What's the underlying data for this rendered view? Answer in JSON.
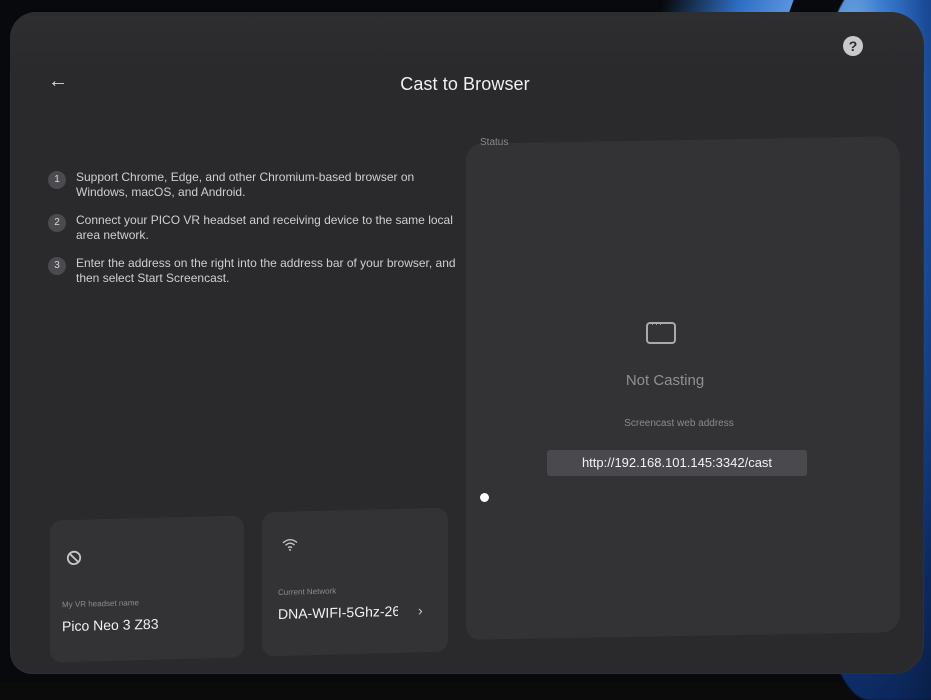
{
  "header": {
    "title": "Cast to Browser",
    "back_icon": "arrow-left-icon",
    "help_icon": "help-icon",
    "help_glyph": "?"
  },
  "steps": [
    {
      "number": "1",
      "text": "Support Chrome, Edge, and other Chromium-based browser on Windows, macOS, and Android."
    },
    {
      "number": "2",
      "text": "Connect your PICO VR headset and receiving device to the same local area network."
    },
    {
      "number": "3",
      "text": "Enter the address on the right into the address bar of your browser, and then select Start Screencast."
    }
  ],
  "status": {
    "label": "Status",
    "state": "Not Casting",
    "address_label": "Screencast web address",
    "address": "http://192.168.101.145:3342/cast",
    "icon": "screen-icon"
  },
  "headset_card": {
    "icon": "no-sign-icon",
    "label": "My VR headset name",
    "value": "Pico Neo 3 Z83"
  },
  "network_card": {
    "icon": "wifi-icon",
    "label": "Current Network",
    "value": "DNA-WIFI-5Ghz-26",
    "chevron": "chevron-right-icon"
  }
}
